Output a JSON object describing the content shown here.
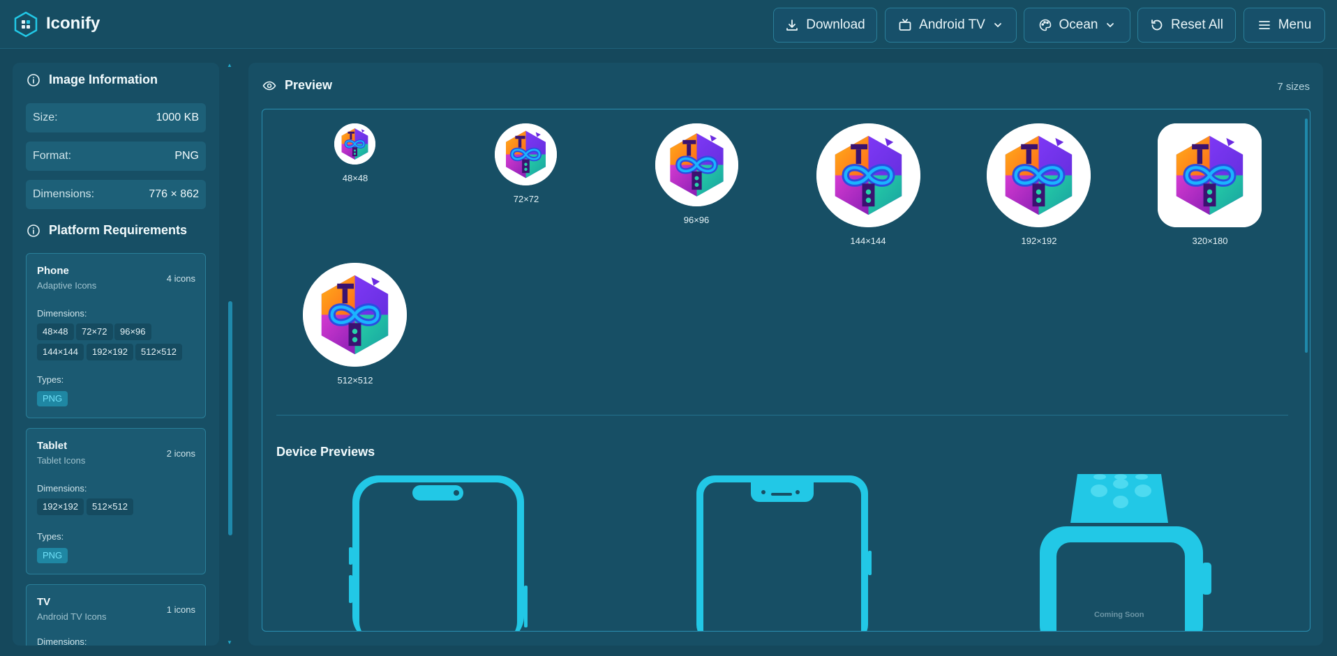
{
  "app": {
    "title": "Iconify"
  },
  "toolbar": {
    "download": "Download",
    "platform": "Android TV",
    "theme": "Ocean",
    "reset": "Reset All",
    "menu": "Menu"
  },
  "image_info": {
    "title": "Image Information",
    "rows": [
      {
        "label": "Size:",
        "value": "1000 KB"
      },
      {
        "label": "Format:",
        "value": "PNG"
      },
      {
        "label": "Dimensions:",
        "value": "776 × 862"
      }
    ]
  },
  "platform_requirements": {
    "title": "Platform Requirements",
    "dimensions_label": "Dimensions:",
    "types_label": "Types:",
    "platforms": [
      {
        "name": "Phone",
        "subtitle": "Adaptive Icons",
        "count": "4 icons",
        "dimensions": [
          "48×48",
          "72×72",
          "96×96",
          "144×144",
          "192×192",
          "512×512"
        ],
        "types": [
          "PNG"
        ]
      },
      {
        "name": "Tablet",
        "subtitle": "Tablet Icons",
        "count": "2 icons",
        "dimensions": [
          "192×192",
          "512×512"
        ],
        "types": [
          "PNG"
        ]
      },
      {
        "name": "TV",
        "subtitle": "Android TV Icons",
        "count": "1 icons",
        "dimensions": [],
        "types": []
      }
    ]
  },
  "preview": {
    "title": "Preview",
    "count": "7 sizes",
    "icons": [
      {
        "label": "48×48"
      },
      {
        "label": "72×72"
      },
      {
        "label": "96×96"
      },
      {
        "label": "144×144"
      },
      {
        "label": "192×192"
      },
      {
        "label": "320×180"
      },
      {
        "label": "512×512"
      }
    ]
  },
  "device_previews": {
    "title": "Device Previews",
    "watch_text": "Coming Soon"
  },
  "colors": {
    "background": "#15485c",
    "panel": "#174f65",
    "accent": "#22c8e6",
    "border": "#2a7f99"
  },
  "icon_names": [
    "app-logo-icon",
    "download-icon",
    "tv-icon",
    "palette-icon",
    "reset-icon",
    "menu-icon",
    "info-icon",
    "eye-icon",
    "chevron-down-icon"
  ]
}
